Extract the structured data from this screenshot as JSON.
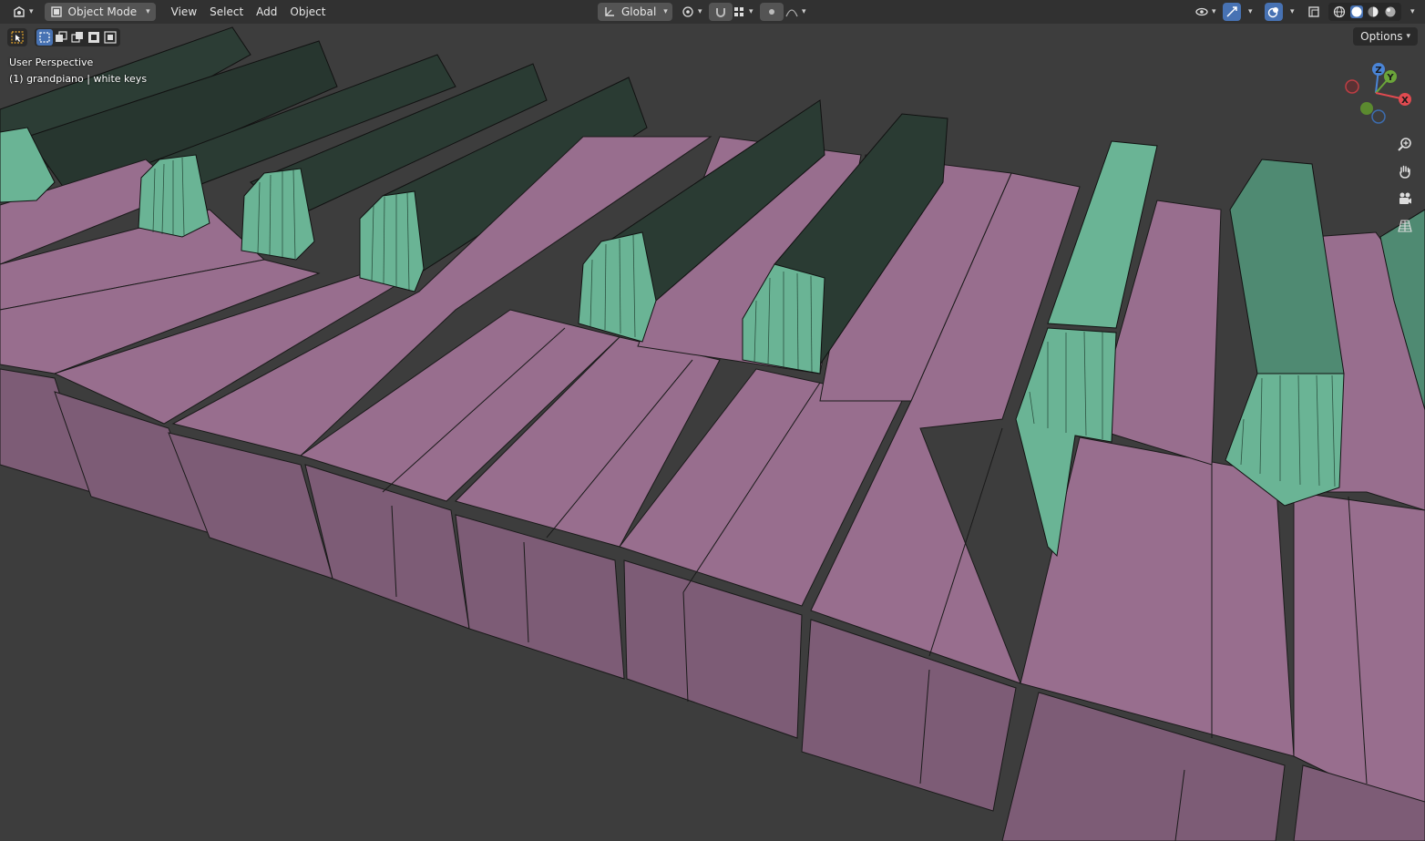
{
  "header": {
    "editor_icon": "editor-type-icon",
    "mode": "Object Mode",
    "menus": [
      "View",
      "Select",
      "Add",
      "Object"
    ],
    "orientation": "Global",
    "options_label": "Options"
  },
  "viewport": {
    "perspective_label": "User Perspective",
    "object_label": "(1) grandpiano | white keys"
  },
  "gizmo": {
    "z_label": "Z",
    "y_label": "Y",
    "x_label": "X"
  },
  "colors": {
    "background": "#3d3d3d",
    "white_key": "#986e8e",
    "white_key_side": "#7d5c76",
    "black_key_front": "#6ab495",
    "black_key_top": "#2b4037",
    "wire": "#1a1a1a",
    "accent": "#4772b3"
  }
}
